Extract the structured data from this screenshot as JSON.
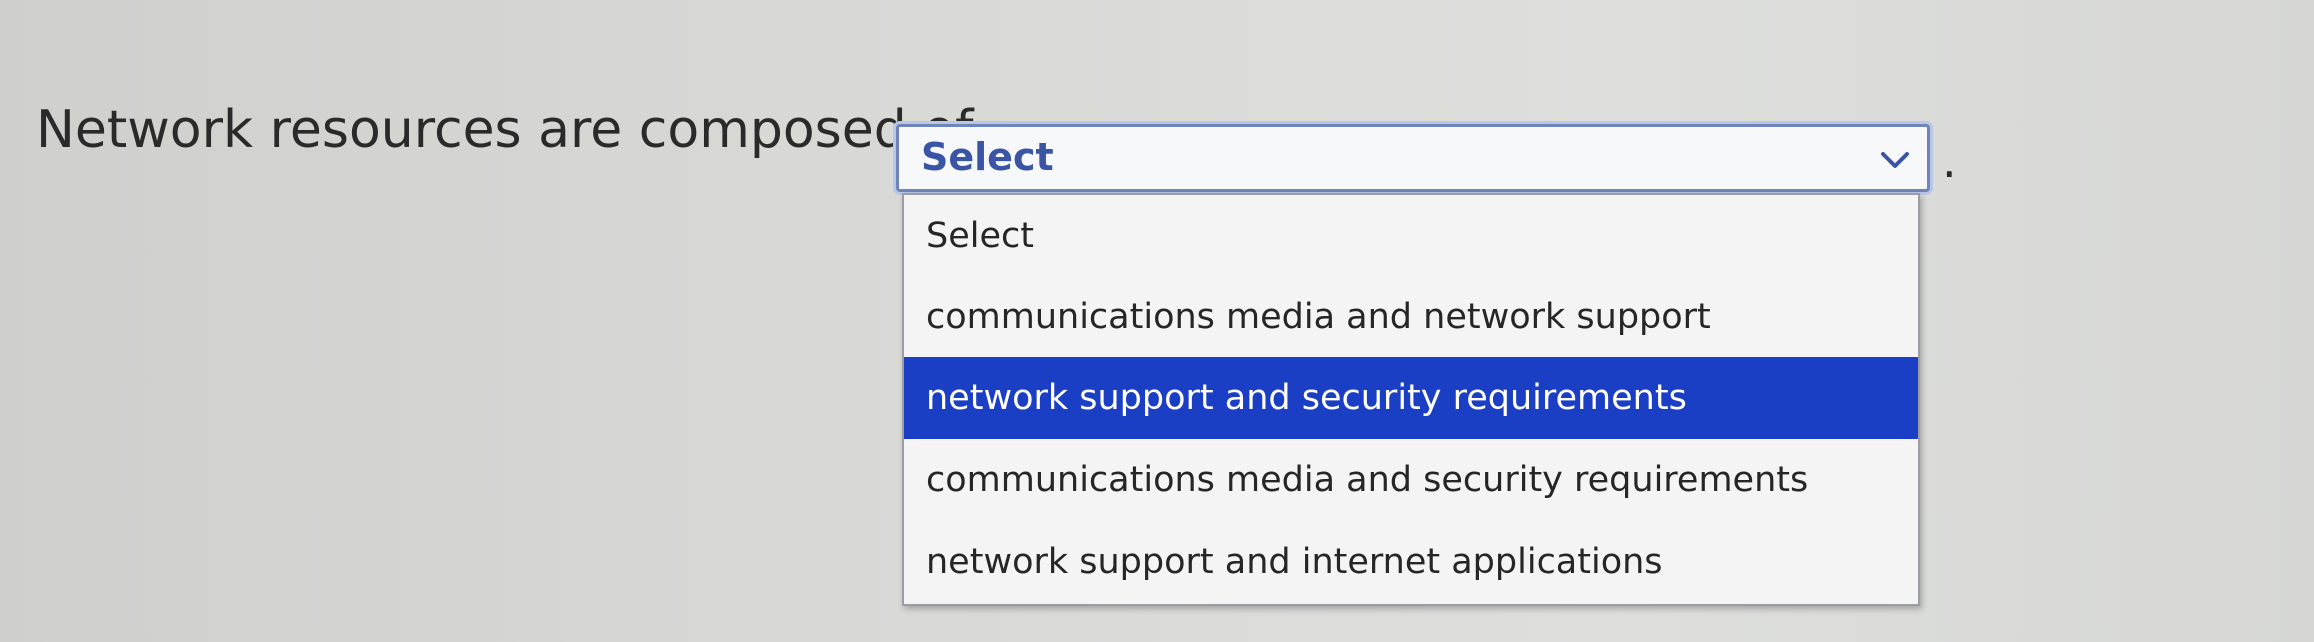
{
  "question": {
    "prefix": "Network resources are composed of",
    "suffix": "."
  },
  "select": {
    "value": "Select",
    "chevron_icon": "chevron-down-icon",
    "accent_color": "#3a55a6",
    "options": [
      {
        "label": "Select",
        "highlighted": false
      },
      {
        "label": "communications media and network support",
        "highlighted": false
      },
      {
        "label": "network support and security requirements",
        "highlighted": true
      },
      {
        "label": "communications media and security requirements",
        "highlighted": false
      },
      {
        "label": "network support and internet applications",
        "highlighted": false
      }
    ],
    "highlight_color": "#1a3ec4"
  }
}
